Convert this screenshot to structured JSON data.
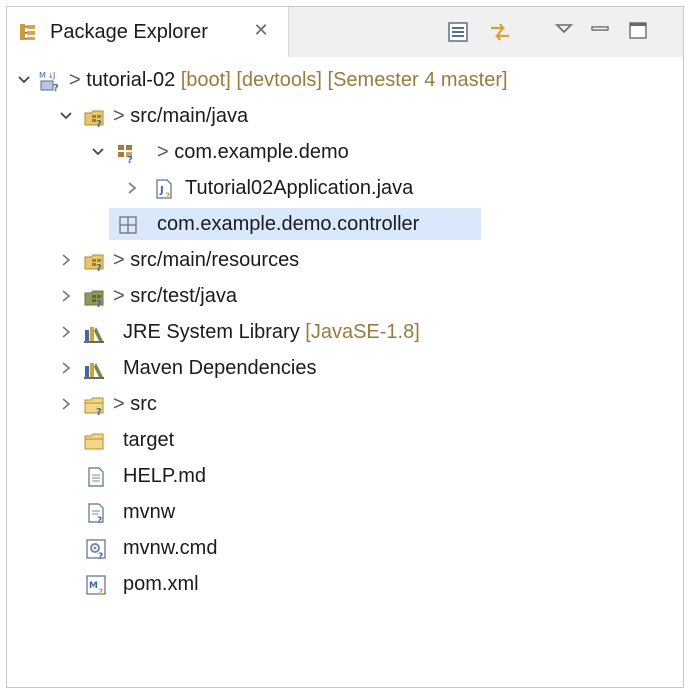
{
  "view": {
    "tab_label": "Package Explorer",
    "close_glyph": "✕"
  },
  "toolbar": {
    "collapse_all_icon": "collapse-all-icon",
    "link_editor_icon": "link-with-editor-icon",
    "view_menu_icon": "view-menu-icon",
    "minimize_icon": "minimize-icon",
    "maximize_icon": "maximize-icon"
  },
  "tree": {
    "project": {
      "prefix": ">",
      "name": "tutorial-02",
      "decorations": "[boot] [devtools] [Semester 4 master]"
    },
    "src_main_java": {
      "prefix": ">",
      "name": "src/main/java"
    },
    "pkg_demo": {
      "prefix": ">",
      "name": "com.example.demo"
    },
    "app_file": {
      "name": "Tutorial02Application.java"
    },
    "pkg_controller": {
      "name": "com.example.demo.controller"
    },
    "src_main_resources": {
      "prefix": ">",
      "name": "src/main/resources"
    },
    "src_test_java": {
      "prefix": ">",
      "name": "src/test/java"
    },
    "jre": {
      "name": "JRE System Library",
      "decoration": "[JavaSE-1.8]"
    },
    "maven": {
      "name": "Maven Dependencies"
    },
    "src": {
      "prefix": ">",
      "name": "src"
    },
    "target": {
      "name": "target"
    },
    "help": {
      "name": "HELP.md"
    },
    "mvnw": {
      "name": "mvnw"
    },
    "mvnw_cmd": {
      "name": "mvnw.cmd"
    },
    "pom": {
      "name": "pom.xml"
    }
  },
  "colors": {
    "selection": "#d9e8fb",
    "decoration": "#9b7b3a",
    "folder": "#e8c66a",
    "package": "#a8783c"
  }
}
